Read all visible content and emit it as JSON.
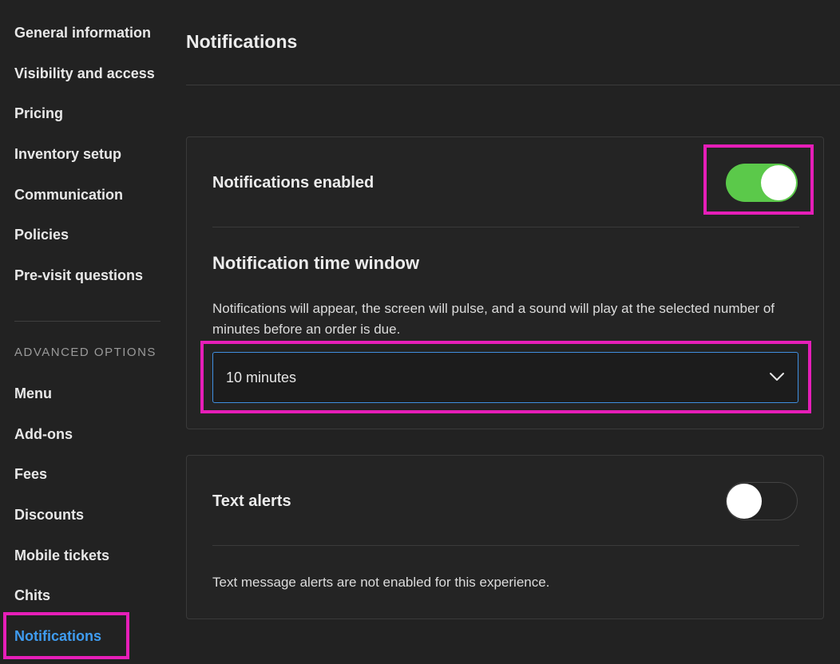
{
  "sidebar": {
    "items": [
      {
        "label": "General information"
      },
      {
        "label": "Visibility and access"
      },
      {
        "label": "Pricing"
      },
      {
        "label": "Inventory setup"
      },
      {
        "label": "Communication"
      },
      {
        "label": "Policies"
      },
      {
        "label": "Pre-visit questions"
      }
    ],
    "section_label": "ADVANCED OPTIONS",
    "advanced_items": [
      {
        "label": "Menu"
      },
      {
        "label": "Add-ons"
      },
      {
        "label": "Fees"
      },
      {
        "label": "Discounts"
      },
      {
        "label": "Mobile tickets"
      },
      {
        "label": "Chits"
      },
      {
        "label": "Notifications",
        "active": true
      }
    ]
  },
  "main": {
    "title": "Notifications",
    "notifications_card": {
      "toggle_label": "Notifications enabled",
      "toggle_on": true,
      "time_window_heading": "Notification time window",
      "time_window_description": "Notifications will appear, the screen will pulse, and a sound will play at the selected number of minutes before an order is due.",
      "select_value": "10 minutes"
    },
    "text_alerts_card": {
      "toggle_label": "Text alerts",
      "toggle_on": false,
      "description": "Text message alerts are not enabled for this experience."
    }
  },
  "colors": {
    "background": "#222222",
    "accent_blue": "#3f9cf0",
    "toggle_green": "#5bc94a",
    "highlight_magenta": "#e61eb8"
  },
  "icons": {
    "select_chevron": "chevron-down-icon"
  }
}
